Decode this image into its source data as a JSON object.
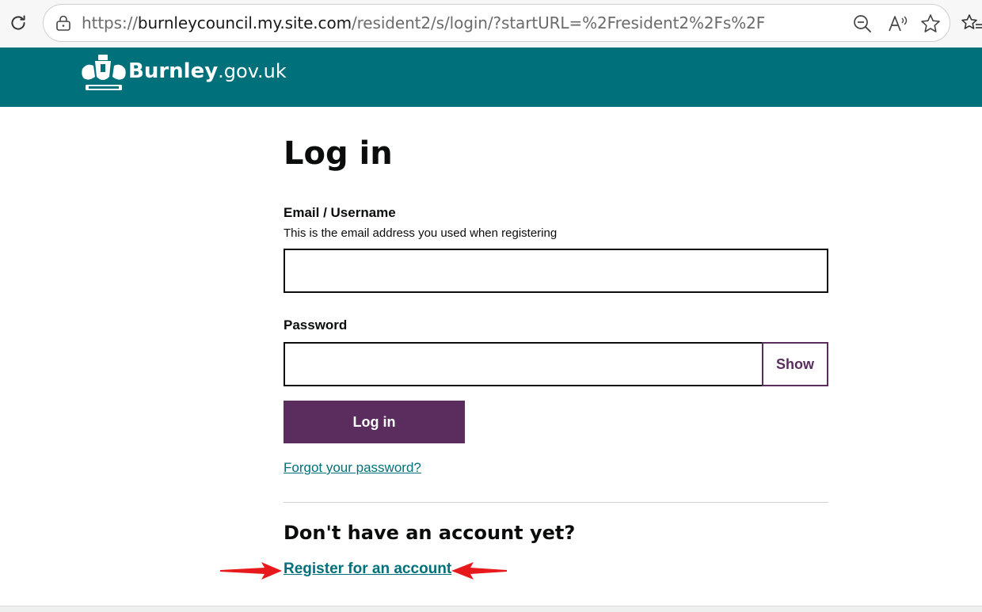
{
  "browser": {
    "url_prefix": "https://",
    "url_domain": "burnleycouncil.my.site.com",
    "url_path": "/resident2/s/login/?startURL=%2Fresident2%2Fs%2F",
    "icons": [
      "reload-icon",
      "lock-icon",
      "zoom-out-icon",
      "read-aloud-icon",
      "favorite-star-icon",
      "favorites-icon"
    ]
  },
  "header": {
    "logo_bold": "Burnley",
    "logo_light": ".gov.uk",
    "brand_color": "#00707a"
  },
  "login": {
    "title": "Log in",
    "email_label": "Email / Username",
    "email_hint": "This is the email address you used when registering",
    "email_value": "",
    "password_label": "Password",
    "password_value": "",
    "show_label": "Show",
    "submit_label": "Log in",
    "forgot_label": "Forgot your password?",
    "accent_color": "#5b2d5f"
  },
  "register": {
    "heading": "Don't have an account yet?",
    "link_label": "Register for an account"
  },
  "annotations": {
    "arrow_color": "#e8191c"
  }
}
